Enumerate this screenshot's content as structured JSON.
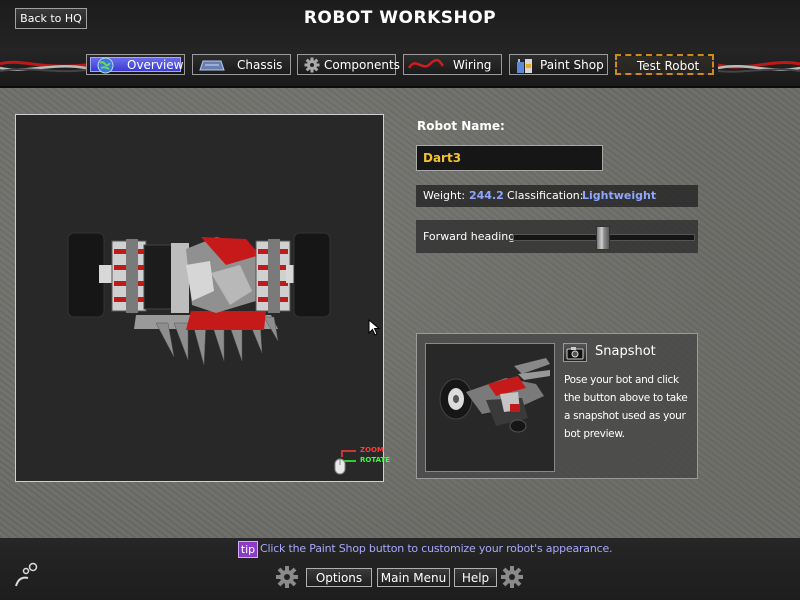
{
  "header": {
    "back_label": "Back to HQ",
    "title": "ROBOT WORKSHOP"
  },
  "tabs": [
    {
      "label": "Overview",
      "icon": "globe-icon",
      "selected": true
    },
    {
      "label": "Chassis",
      "icon": "chassis-icon"
    },
    {
      "label": "Components",
      "icon": "gear-icon"
    },
    {
      "label": "Wiring",
      "icon": "wire-icon"
    },
    {
      "label": "Paint Shop",
      "icon": "paint-cans-icon"
    },
    {
      "label": "Test Robot"
    }
  ],
  "viewport": {
    "zoom_hint": "ZOOM",
    "rotate_hint": "ROTATE"
  },
  "robot": {
    "name_label": "Robot Name:",
    "name": "Dart3",
    "weight_label": "Weight:",
    "weight": "244.2",
    "class_label": "Classification:",
    "classification": "Lightweight",
    "heading_label": "Forward heading:",
    "heading_fraction": 0.49
  },
  "snapshot": {
    "title": "Snapshot",
    "description": "Pose your bot and click the button above to take a snapshot used as your bot preview."
  },
  "footer": {
    "tip_badge": "tip",
    "tip_text": "Click the Paint Shop button to customize your robot's appearance.",
    "options_label": "Options",
    "main_menu_label": "Main Menu",
    "help_label": "Help"
  },
  "colors": {
    "accent_blue": "#8fa6ff",
    "name_yellow": "#f2c230",
    "tab_selected": "#4a4ae0",
    "tip_purple": "#8a3cc8"
  }
}
